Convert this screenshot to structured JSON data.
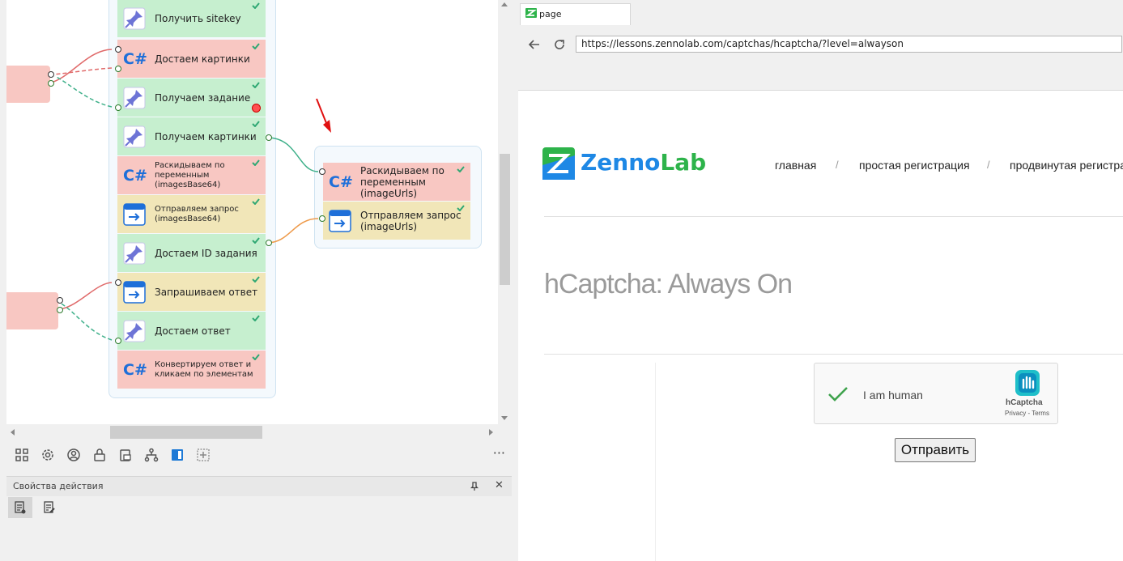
{
  "workflow": {
    "blocks": [
      {
        "label": "Получить sitekey",
        "type": "pin",
        "color": "green"
      },
      {
        "label": "Достаем картинки",
        "type": "csharp",
        "color": "red"
      },
      {
        "label": "Получаем задание",
        "type": "pin",
        "color": "green"
      },
      {
        "label": "Получаем картинки",
        "type": "pin",
        "color": "green"
      },
      {
        "label": "Раскидываем по переменным (imagesBase64)",
        "type": "csharp",
        "color": "red"
      },
      {
        "label": "Отправляем запрос (imagesBase64)",
        "type": "request",
        "color": "yellow"
      },
      {
        "label": "Достаем ID задания",
        "type": "pin",
        "color": "green"
      },
      {
        "label": "Запрашиваем ответ",
        "type": "request",
        "color": "yellow"
      },
      {
        "label": "Достаем ответ",
        "type": "pin",
        "color": "green"
      },
      {
        "label": "Конвертируем ответ и кликаем по элементам",
        "type": "csharp",
        "color": "red"
      }
    ],
    "side_blocks": [
      {
        "label": "Раскидываем по переменным (imageUrls)",
        "type": "csharp",
        "color": "red"
      },
      {
        "label": "Отправляем запрос (imageUrls)",
        "type": "request",
        "color": "yellow"
      }
    ],
    "csharp_glyph": "C#"
  },
  "toolbar": {
    "icons": [
      "grid-icon",
      "gear-icon",
      "user-icon",
      "lock-icon",
      "database-icon",
      "hierarchy-icon",
      "book-icon",
      "add-frame-icon"
    ],
    "more_label": "···"
  },
  "properties": {
    "title": "Свойства действия",
    "pin_label": "pin",
    "close_label": "✕"
  },
  "browser": {
    "tab_title": "page",
    "url": "https://lessons.zennolab.com/captchas/hcaptcha/?level=alwayson"
  },
  "site": {
    "logo_zenno": "Zenno",
    "logo_lab": "Lab",
    "nav": [
      "главная",
      "простая регистрация",
      "продвинутая регистра"
    ],
    "nav_separator": "/",
    "heading": "hCaptcha: Always On",
    "captcha": {
      "label": "I am human",
      "brand": "hCaptcha",
      "links": "Privacy - Terms"
    },
    "submit_label": "Отправить"
  },
  "colors": {
    "green_block": "#c6efcf",
    "red_block": "#f8c7c2",
    "yellow_block": "#f1e6b8",
    "zennolab_green": "#2db34a",
    "zennolab_blue": "#1e88e5",
    "check": "#2fa873"
  }
}
